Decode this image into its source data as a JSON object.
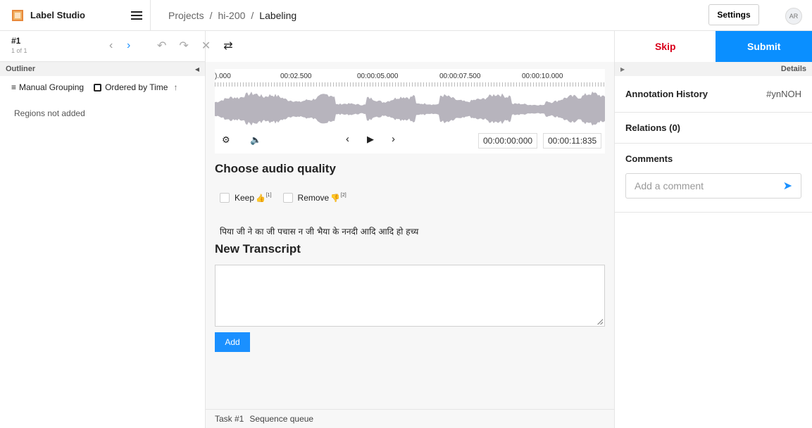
{
  "header": {
    "brand": "Label Studio",
    "breadcrumbs": [
      "Projects",
      "/",
      "hi-200",
      "/",
      "Labeling"
    ],
    "settings_label": "Settings",
    "avatar_initials": "AR"
  },
  "task_nav": {
    "task_number": "#1",
    "task_position": "1 of 1"
  },
  "outliner": {
    "title": "Outliner",
    "grouping_label": "Manual Grouping",
    "ordering_label": "Ordered by Time",
    "empty_text": "Regions not added"
  },
  "audio": {
    "timeline_labels": [
      ").000",
      "00:02.500",
      "00:00:05.000",
      "00:00:07.500",
      "00:00:10.000"
    ],
    "current_time": "00:00:00:000",
    "duration": "00:00:11:835"
  },
  "form": {
    "quality_heading": "Choose audio quality",
    "choices": [
      {
        "label": "Keep",
        "hotkey": "[1]",
        "emoji": "👍"
      },
      {
        "label": "Remove",
        "hotkey": "[2]",
        "emoji": "👎"
      }
    ],
    "transcript_text": "पिया जी ने का जी पचास न जी भैया के ननदी आदि आदि हो हच्य",
    "new_transcript_heading": "New Transcript",
    "add_label": "Add"
  },
  "footer": {
    "task": "Task #1",
    "queue": "Sequence queue"
  },
  "right_panel": {
    "skip_label": "Skip",
    "submit_label": "Submit",
    "details_label": "Details",
    "annotation_history_label": "Annotation History",
    "annotation_id": "#ynNOH",
    "relations_label": "Relations (0)",
    "comments_label": "Comments",
    "comment_placeholder": "Add a comment"
  },
  "colors": {
    "accent": "#0a8fff",
    "skip": "#d9001b",
    "waveform": "#b7b4bd"
  }
}
